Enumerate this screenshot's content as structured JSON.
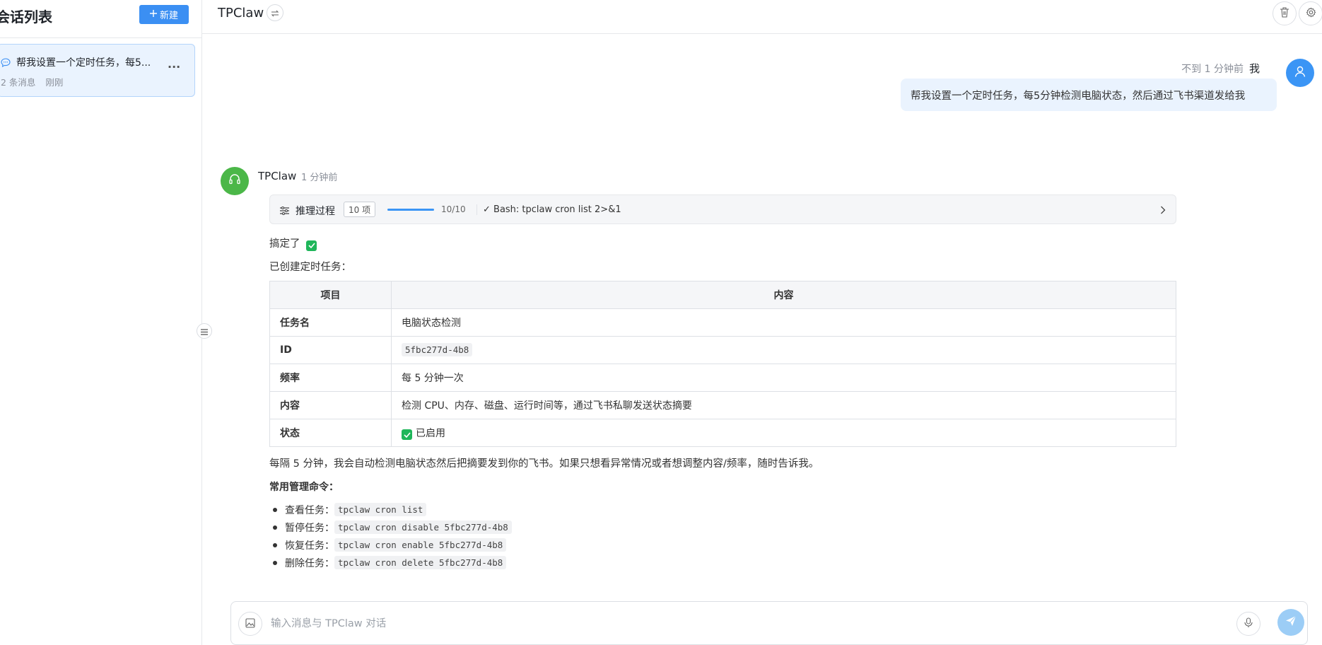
{
  "sidebar": {
    "title": "会话列表",
    "new_button": "新建",
    "conversations": [
      {
        "title": "帮我设置一个定时任务，每5...",
        "count": "2 条消息",
        "time": "刚刚",
        "more": "..."
      }
    ]
  },
  "header": {
    "title": "TPClaw"
  },
  "user_message": {
    "time": "不到 1 分钟前",
    "name": "我",
    "text": "帮我设置一个定时任务，每5分钟检测电脑状态，然后通过飞书渠道发给我"
  },
  "bot_message": {
    "name": "TPClaw",
    "time": "1 分钟前",
    "reasoning": {
      "label": "推理过程",
      "count": "10 项",
      "progress_text": "10/10",
      "progress": 1.0,
      "last_step": "✓ Bash: tpclaw cron list 2>&1"
    },
    "line1": "搞定了",
    "line2": "已创建定时任务：",
    "table": {
      "headers": [
        "项目",
        "内容"
      ],
      "rows": [
        {
          "key": "任务名",
          "value": "电脑状态检测"
        },
        {
          "key": "ID",
          "value": "5fbc277d-4b8"
        },
        {
          "key": "频率",
          "value": "每 5 分钟一次"
        },
        {
          "key": "内容",
          "value": "检测 CPU、内存、磁盘、运行时间等，通过飞书私聊发送状态摘要"
        },
        {
          "key": "状态",
          "value": "已启用"
        }
      ]
    },
    "summary": "每隔 5 分钟，我会自动检测电脑状态然后把摘要发到你的飞书。如果只想看异常情况或者想调整内容/频率，随时告诉我。",
    "commands_title": "常用管理命令：",
    "commands": [
      {
        "label": "查看任务：",
        "code": "tpclaw cron list"
      },
      {
        "label": "暂停任务：",
        "code": "tpclaw cron disable 5fbc277d-4b8"
      },
      {
        "label": "恢复任务：",
        "code": "tpclaw cron enable 5fbc277d-4b8"
      },
      {
        "label": "删除任务：",
        "code": "tpclaw cron delete 5fbc277d-4b8"
      }
    ]
  },
  "input": {
    "placeholder": "输入消息与 TPClaw 对话",
    "value": ""
  },
  "colors": {
    "accent": "#3b8ff3",
    "user_bubble": "#eaf3fe",
    "bot_avatar": "#4bb748",
    "check": "#1fb65a"
  },
  "icons": [
    "chat-bubble-icon",
    "plus-icon",
    "swap-icon",
    "trash-icon",
    "gear-icon",
    "user-icon",
    "headset-icon",
    "sliders-icon",
    "chevron-right-icon",
    "menu-icon",
    "image-icon",
    "mic-icon",
    "send-icon",
    "check-icon"
  ]
}
